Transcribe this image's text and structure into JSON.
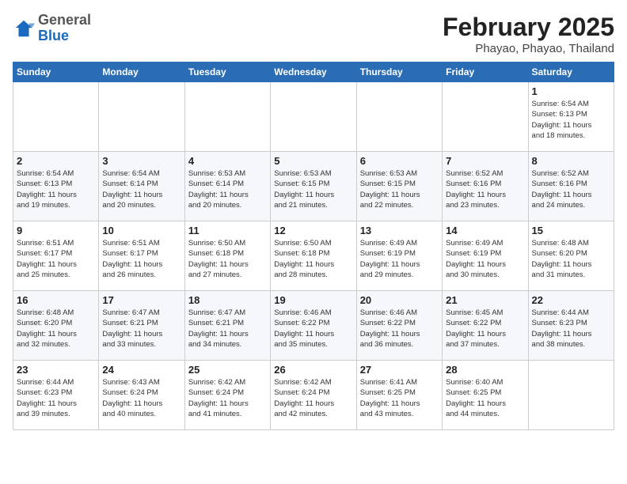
{
  "header": {
    "logo_general": "General",
    "logo_blue": "Blue",
    "month_year": "February 2025",
    "location": "Phayao, Phayao, Thailand"
  },
  "weekdays": [
    "Sunday",
    "Monday",
    "Tuesday",
    "Wednesday",
    "Thursday",
    "Friday",
    "Saturday"
  ],
  "weeks": [
    [
      {
        "day": "",
        "detail": ""
      },
      {
        "day": "",
        "detail": ""
      },
      {
        "day": "",
        "detail": ""
      },
      {
        "day": "",
        "detail": ""
      },
      {
        "day": "",
        "detail": ""
      },
      {
        "day": "",
        "detail": ""
      },
      {
        "day": "1",
        "detail": "Sunrise: 6:54 AM\nSunset: 6:13 PM\nDaylight: 11 hours\nand 18 minutes."
      }
    ],
    [
      {
        "day": "2",
        "detail": "Sunrise: 6:54 AM\nSunset: 6:13 PM\nDaylight: 11 hours\nand 19 minutes."
      },
      {
        "day": "3",
        "detail": "Sunrise: 6:54 AM\nSunset: 6:14 PM\nDaylight: 11 hours\nand 20 minutes."
      },
      {
        "day": "4",
        "detail": "Sunrise: 6:53 AM\nSunset: 6:14 PM\nDaylight: 11 hours\nand 20 minutes."
      },
      {
        "day": "5",
        "detail": "Sunrise: 6:53 AM\nSunset: 6:15 PM\nDaylight: 11 hours\nand 21 minutes."
      },
      {
        "day": "6",
        "detail": "Sunrise: 6:53 AM\nSunset: 6:15 PM\nDaylight: 11 hours\nand 22 minutes."
      },
      {
        "day": "7",
        "detail": "Sunrise: 6:52 AM\nSunset: 6:16 PM\nDaylight: 11 hours\nand 23 minutes."
      },
      {
        "day": "8",
        "detail": "Sunrise: 6:52 AM\nSunset: 6:16 PM\nDaylight: 11 hours\nand 24 minutes."
      }
    ],
    [
      {
        "day": "9",
        "detail": "Sunrise: 6:51 AM\nSunset: 6:17 PM\nDaylight: 11 hours\nand 25 minutes."
      },
      {
        "day": "10",
        "detail": "Sunrise: 6:51 AM\nSunset: 6:17 PM\nDaylight: 11 hours\nand 26 minutes."
      },
      {
        "day": "11",
        "detail": "Sunrise: 6:50 AM\nSunset: 6:18 PM\nDaylight: 11 hours\nand 27 minutes."
      },
      {
        "day": "12",
        "detail": "Sunrise: 6:50 AM\nSunset: 6:18 PM\nDaylight: 11 hours\nand 28 minutes."
      },
      {
        "day": "13",
        "detail": "Sunrise: 6:49 AM\nSunset: 6:19 PM\nDaylight: 11 hours\nand 29 minutes."
      },
      {
        "day": "14",
        "detail": "Sunrise: 6:49 AM\nSunset: 6:19 PM\nDaylight: 11 hours\nand 30 minutes."
      },
      {
        "day": "15",
        "detail": "Sunrise: 6:48 AM\nSunset: 6:20 PM\nDaylight: 11 hours\nand 31 minutes."
      }
    ],
    [
      {
        "day": "16",
        "detail": "Sunrise: 6:48 AM\nSunset: 6:20 PM\nDaylight: 11 hours\nand 32 minutes."
      },
      {
        "day": "17",
        "detail": "Sunrise: 6:47 AM\nSunset: 6:21 PM\nDaylight: 11 hours\nand 33 minutes."
      },
      {
        "day": "18",
        "detail": "Sunrise: 6:47 AM\nSunset: 6:21 PM\nDaylight: 11 hours\nand 34 minutes."
      },
      {
        "day": "19",
        "detail": "Sunrise: 6:46 AM\nSunset: 6:22 PM\nDaylight: 11 hours\nand 35 minutes."
      },
      {
        "day": "20",
        "detail": "Sunrise: 6:46 AM\nSunset: 6:22 PM\nDaylight: 11 hours\nand 36 minutes."
      },
      {
        "day": "21",
        "detail": "Sunrise: 6:45 AM\nSunset: 6:22 PM\nDaylight: 11 hours\nand 37 minutes."
      },
      {
        "day": "22",
        "detail": "Sunrise: 6:44 AM\nSunset: 6:23 PM\nDaylight: 11 hours\nand 38 minutes."
      }
    ],
    [
      {
        "day": "23",
        "detail": "Sunrise: 6:44 AM\nSunset: 6:23 PM\nDaylight: 11 hours\nand 39 minutes."
      },
      {
        "day": "24",
        "detail": "Sunrise: 6:43 AM\nSunset: 6:24 PM\nDaylight: 11 hours\nand 40 minutes."
      },
      {
        "day": "25",
        "detail": "Sunrise: 6:42 AM\nSunset: 6:24 PM\nDaylight: 11 hours\nand 41 minutes."
      },
      {
        "day": "26",
        "detail": "Sunrise: 6:42 AM\nSunset: 6:24 PM\nDaylight: 11 hours\nand 42 minutes."
      },
      {
        "day": "27",
        "detail": "Sunrise: 6:41 AM\nSunset: 6:25 PM\nDaylight: 11 hours\nand 43 minutes."
      },
      {
        "day": "28",
        "detail": "Sunrise: 6:40 AM\nSunset: 6:25 PM\nDaylight: 11 hours\nand 44 minutes."
      },
      {
        "day": "",
        "detail": ""
      }
    ]
  ]
}
